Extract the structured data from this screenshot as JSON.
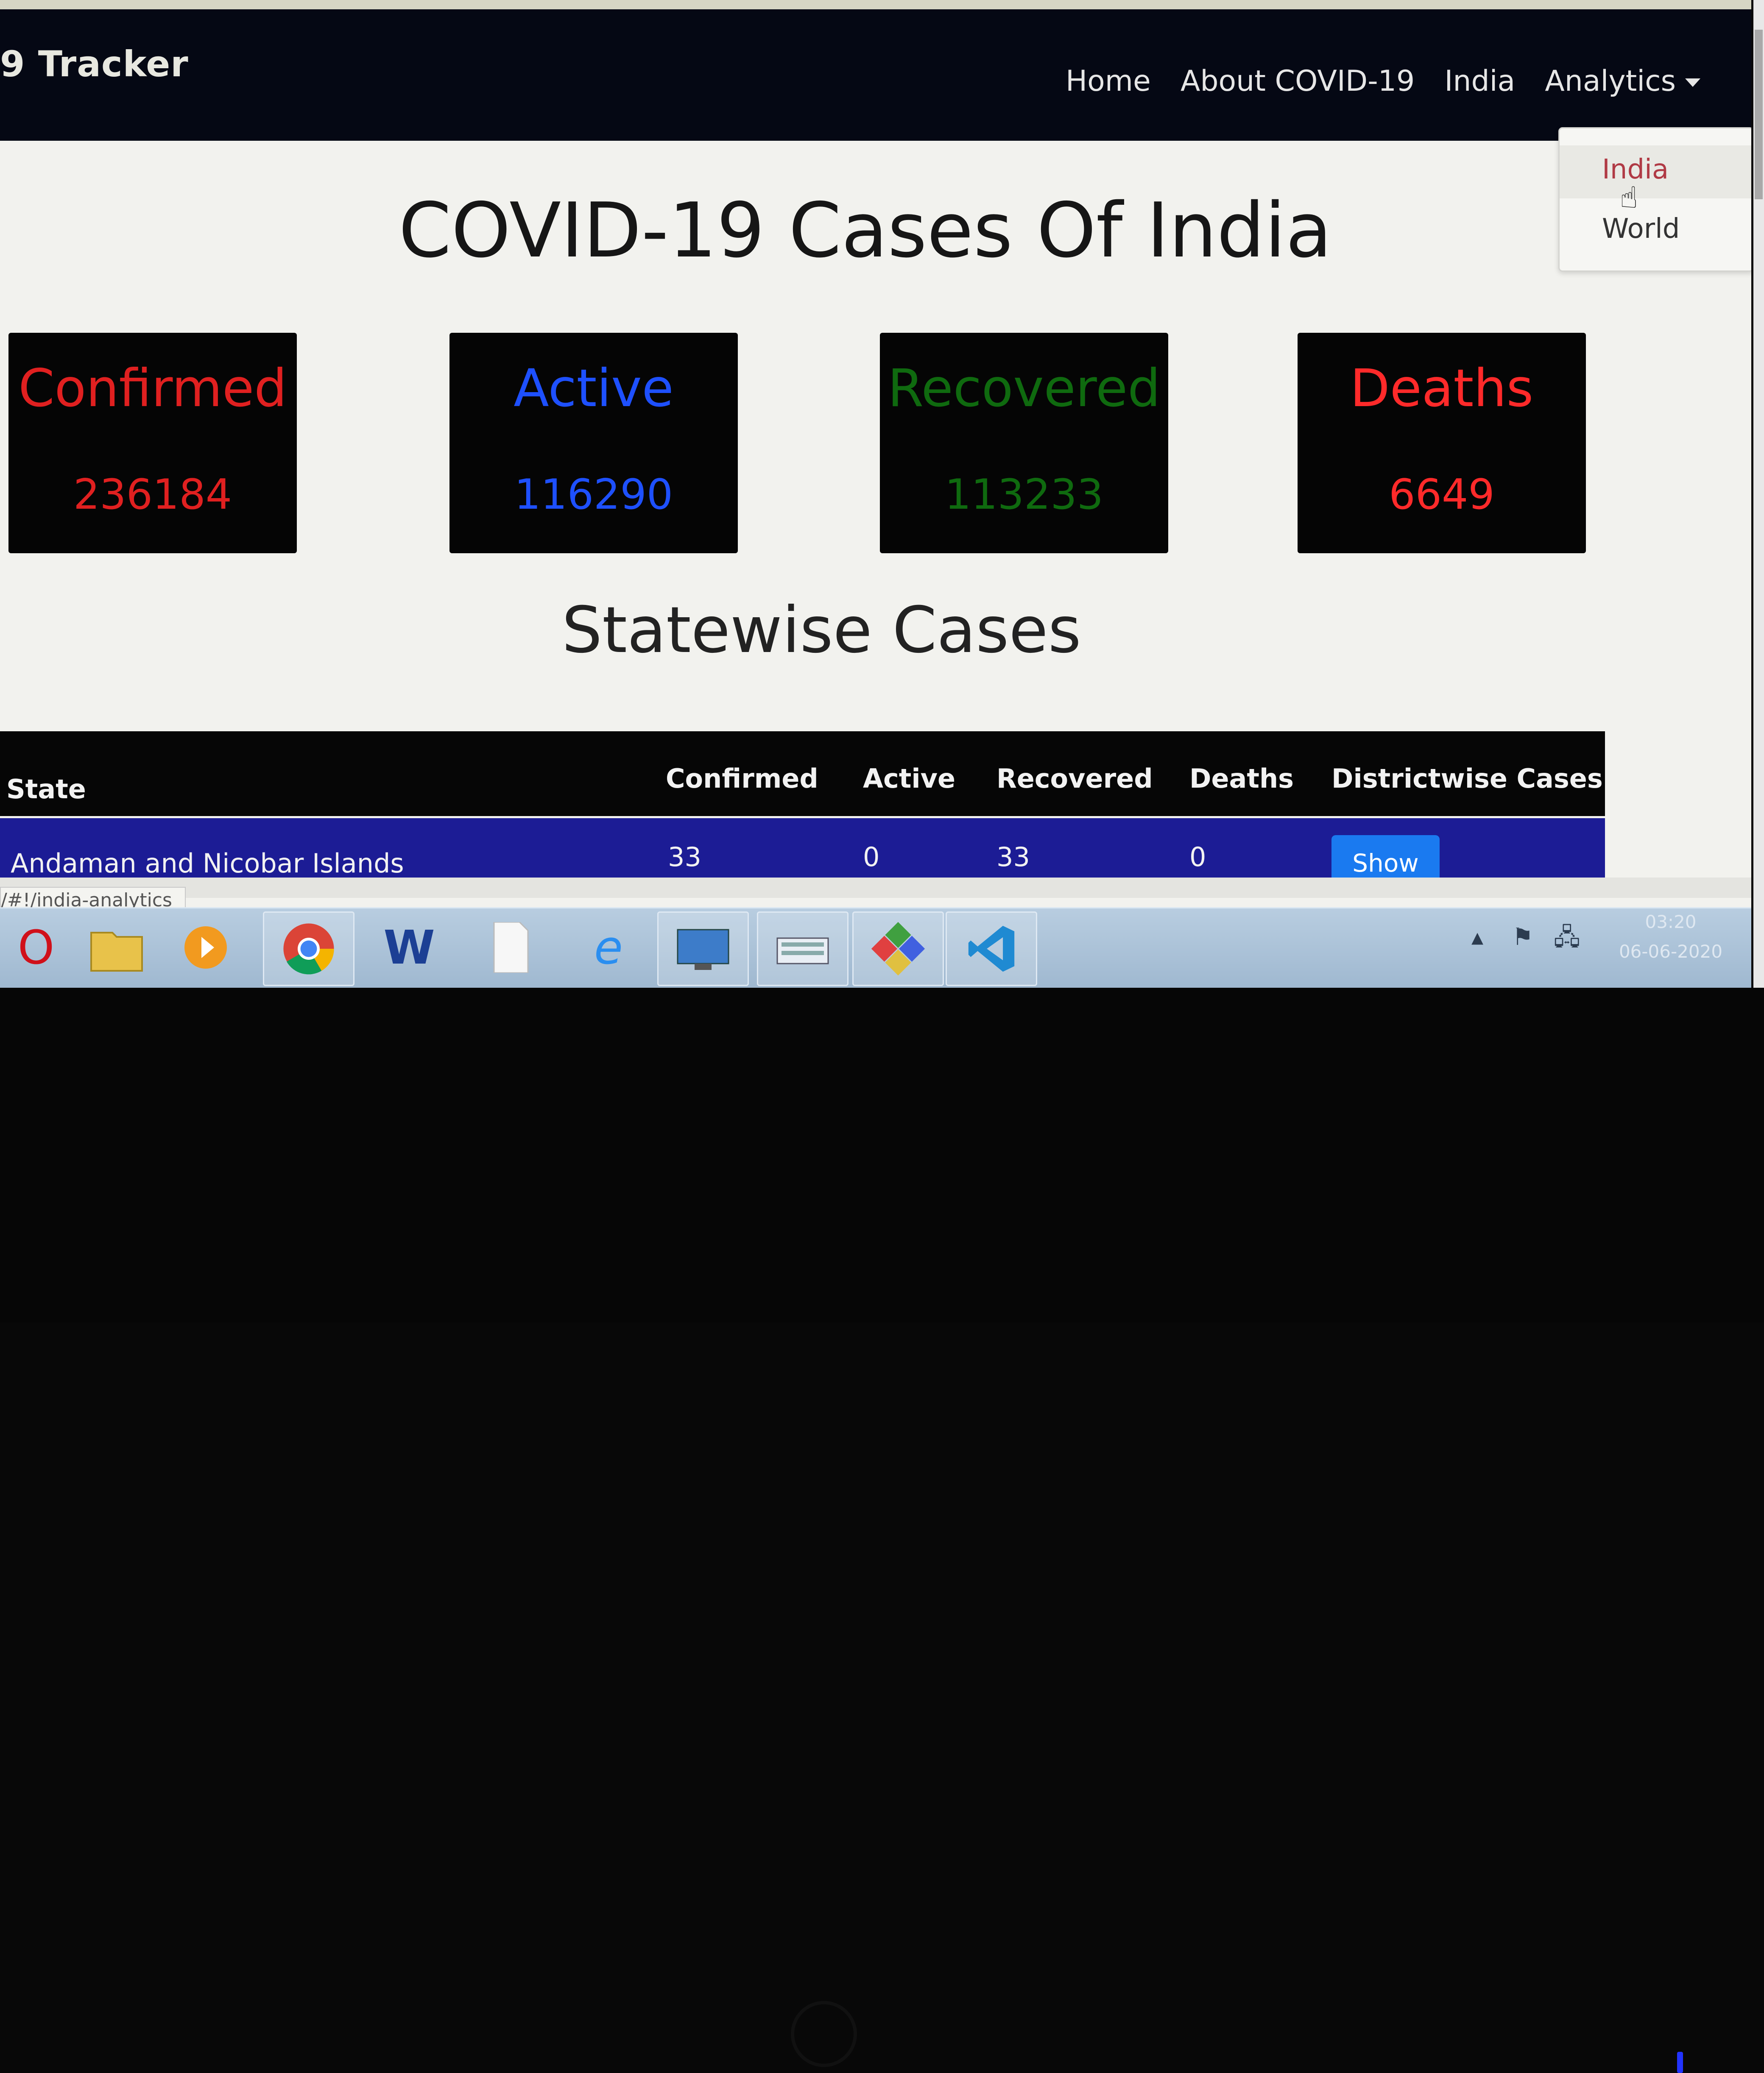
{
  "navbar": {
    "brand": "9 Tracker",
    "links": [
      "Home",
      "About COVID-19",
      "India",
      "Analytics"
    ]
  },
  "dropdown": {
    "items": [
      "India",
      "World"
    ]
  },
  "page_title": "COVID-19 Cases Of India",
  "stats": [
    {
      "label": "Confirmed",
      "value": "236184",
      "color": "#e02020"
    },
    {
      "label": "Active",
      "value": "116290",
      "color": "#1e50ff"
    },
    {
      "label": "Recovered",
      "value": "113233",
      "color": "#0f6a0f"
    },
    {
      "label": "Deaths",
      "value": "6649",
      "color": "#ff2a2a"
    }
  ],
  "section_title": "Statewise Cases",
  "table": {
    "headers": [
      "State",
      "Confirmed",
      "Active",
      "Recovered",
      "Deaths",
      "Districtwise Cases"
    ],
    "rows": [
      {
        "state": "Andaman and Nicobar Islands",
        "confirmed": "33",
        "active": "0",
        "recovered": "33",
        "deaths": "0",
        "action": "Show"
      }
    ]
  },
  "status_url": "/#!/india-analytics",
  "taskbar": {
    "icons": [
      "opera-icon",
      "file-explorer-icon",
      "media-player-icon",
      "chrome-icon",
      "word-icon",
      "blank-document-icon",
      "internet-explorer-icon",
      "remote-desktop-icon",
      "on-screen-keyboard-icon",
      "paint-app-icon",
      "vscode-icon"
    ],
    "clock_time": "03:20",
    "clock_date": "06-06-2020"
  }
}
